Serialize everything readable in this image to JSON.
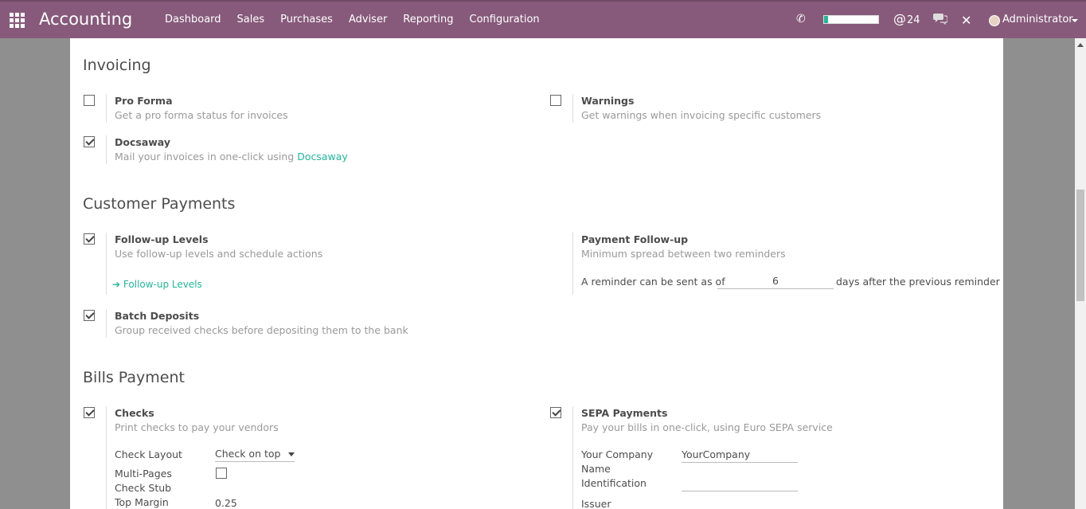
{
  "topbar": {
    "app_title": "Accounting",
    "menu": [
      "Dashboard",
      "Sales",
      "Purchases",
      "Adviser",
      "Reporting",
      "Configuration"
    ],
    "mention_count": "24",
    "user_name": "Administrator",
    "progress_fraction": 0.08,
    "bg_color": "#875a7b",
    "icons": [
      "apps-icon",
      "phone-icon",
      "mention-icon",
      "chat-icon",
      "close-icon",
      "avatar"
    ]
  },
  "invoicing": {
    "title": "Invoicing",
    "pro_forma": {
      "label": "Pro Forma",
      "desc": "Get a pro forma status for invoices",
      "checked": false
    },
    "warnings": {
      "label": "Warnings",
      "desc": "Get warnings when invoicing specific customers",
      "checked": false
    },
    "docsaway": {
      "label": "Docsaway",
      "desc": "Mail your invoices in one-click using ",
      "link": "Docsaway",
      "checked": true
    }
  },
  "customer_payments": {
    "title": "Customer Payments",
    "followup_levels": {
      "label": "Follow-up Levels",
      "desc": "Use follow-up levels and schedule actions",
      "link": "Follow-up Levels",
      "checked": true
    },
    "payment_followup": {
      "label": "Payment Follow-up",
      "desc": "Minimum spread between two reminders",
      "prefix": "A reminder can be sent as of",
      "value": "6",
      "suffix": "days after the previous reminder"
    },
    "batch_deposits": {
      "label": "Batch Deposits",
      "desc": "Group received checks before depositing them to the bank",
      "checked": true
    }
  },
  "bills_payment": {
    "title": "Bills Payment",
    "checks": {
      "label": "Checks",
      "desc": "Print checks to pay your vendors",
      "checked": true,
      "check_layout_label": "Check Layout",
      "check_layout_value": "Check on top",
      "multi_pages_label": "Multi-Pages",
      "check_stub_label": "Check Stub",
      "top_margin_label": "Top Margin",
      "top_margin_value": "0.25"
    },
    "sepa": {
      "label": "SEPA Payments",
      "desc": "Pay your bills in one-click, using Euro SEPA service",
      "checked": true,
      "company_name_label_1": "Your Company",
      "company_name_label_2": "Name",
      "company_name_value": "YourCompany",
      "identification_label": "Identification",
      "identification_value": "",
      "issuer_label": "Issuer"
    }
  }
}
